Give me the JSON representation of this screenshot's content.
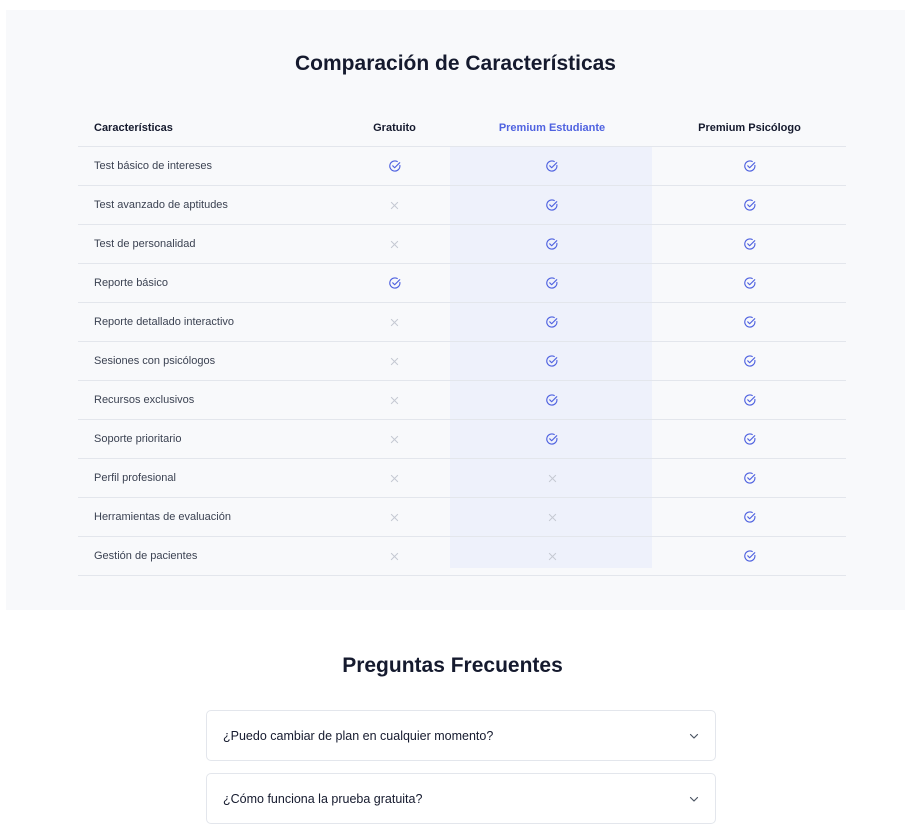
{
  "comparison": {
    "title": "Comparación de Características",
    "headers": {
      "feature": "Características",
      "free": "Gratuito",
      "student": "Premium Estudiante",
      "psychologist": "Premium Psicólogo"
    },
    "highlight_color": "#4f62e0",
    "rows": [
      {
        "feature": "Test básico de intereses",
        "free": true,
        "student": true,
        "psychologist": true
      },
      {
        "feature": "Test avanzado de aptitudes",
        "free": false,
        "student": true,
        "psychologist": true
      },
      {
        "feature": "Test de personalidad",
        "free": false,
        "student": true,
        "psychologist": true
      },
      {
        "feature": "Reporte básico",
        "free": true,
        "student": true,
        "psychologist": true
      },
      {
        "feature": "Reporte detallado interactivo",
        "free": false,
        "student": true,
        "psychologist": true
      },
      {
        "feature": "Sesiones con psicólogos",
        "free": false,
        "student": true,
        "psychologist": true
      },
      {
        "feature": "Recursos exclusivos",
        "free": false,
        "student": true,
        "psychologist": true
      },
      {
        "feature": "Soporte prioritario",
        "free": false,
        "student": true,
        "psychologist": true
      },
      {
        "feature": "Perfil profesional",
        "free": false,
        "student": false,
        "psychologist": true
      },
      {
        "feature": "Herramientas de evaluación",
        "free": false,
        "student": false,
        "psychologist": true
      },
      {
        "feature": "Gestión de pacientes",
        "free": false,
        "student": false,
        "psychologist": true
      }
    ]
  },
  "faq": {
    "title": "Preguntas Frecuentes",
    "items": [
      {
        "question": "¿Puedo cambiar de plan en cualquier momento?",
        "icon": "chevron-down-icon"
      },
      {
        "question": "¿Cómo funciona la prueba gratuita?",
        "icon": "chevron-down-icon"
      }
    ]
  }
}
